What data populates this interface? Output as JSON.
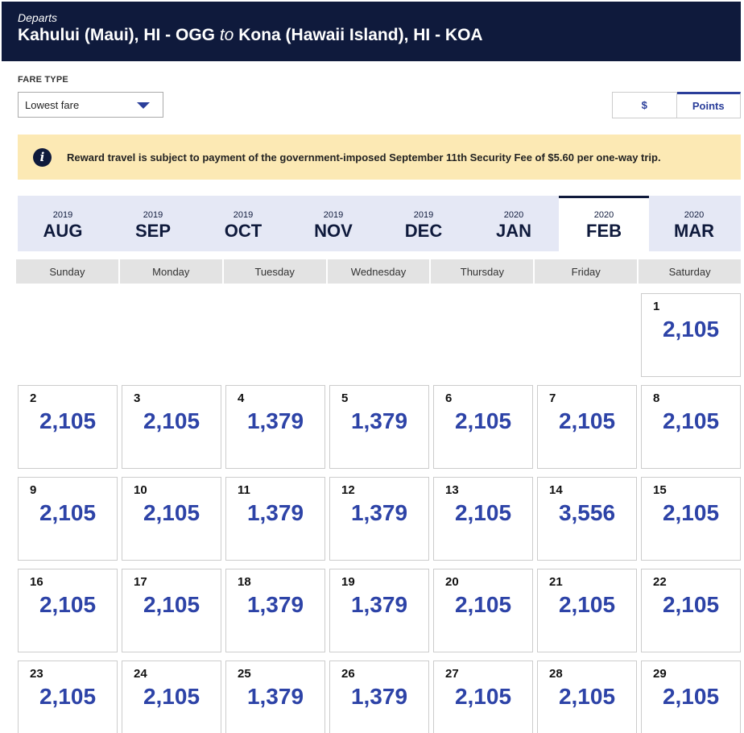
{
  "header": {
    "departs_label": "Departs",
    "origin": "Kahului (Maui), HI - OGG",
    "to_word": "to",
    "destination": "Kona (Hawaii Island), HI - KOA"
  },
  "fare_type": {
    "label": "FARE TYPE",
    "selected": "Lowest fare"
  },
  "currency_toggle": {
    "dollars": "$",
    "points": "Points",
    "active": "points"
  },
  "notice": {
    "icon": "info-icon",
    "message": "Reward travel is subject to payment of the government-imposed September 11th Security Fee of $5.60 per one-way trip."
  },
  "months": [
    {
      "year": "2019",
      "month": "AUG"
    },
    {
      "year": "2019",
      "month": "SEP"
    },
    {
      "year": "2019",
      "month": "OCT"
    },
    {
      "year": "2019",
      "month": "NOV"
    },
    {
      "year": "2019",
      "month": "DEC"
    },
    {
      "year": "2020",
      "month": "JAN"
    },
    {
      "year": "2020",
      "month": "FEB"
    },
    {
      "year": "2020",
      "month": "MAR"
    }
  ],
  "active_month": "FEB",
  "weekdays": [
    "Sunday",
    "Monday",
    "Tuesday",
    "Wednesday",
    "Thursday",
    "Friday",
    "Saturday"
  ],
  "calendar": [
    {
      "day": "1",
      "price": "2,105"
    },
    {
      "day": "2",
      "price": "2,105"
    },
    {
      "day": "3",
      "price": "2,105"
    },
    {
      "day": "4",
      "price": "1,379"
    },
    {
      "day": "5",
      "price": "1,379"
    },
    {
      "day": "6",
      "price": "2,105"
    },
    {
      "day": "7",
      "price": "2,105"
    },
    {
      "day": "8",
      "price": "2,105"
    },
    {
      "day": "9",
      "price": "2,105"
    },
    {
      "day": "10",
      "price": "2,105"
    },
    {
      "day": "11",
      "price": "1,379"
    },
    {
      "day": "12",
      "price": "1,379"
    },
    {
      "day": "13",
      "price": "2,105"
    },
    {
      "day": "14",
      "price": "3,556"
    },
    {
      "day": "15",
      "price": "2,105"
    },
    {
      "day": "16",
      "price": "2,105"
    },
    {
      "day": "17",
      "price": "2,105"
    },
    {
      "day": "18",
      "price": "1,379"
    },
    {
      "day": "19",
      "price": "1,379"
    },
    {
      "day": "20",
      "price": "2,105"
    },
    {
      "day": "21",
      "price": "2,105"
    },
    {
      "day": "22",
      "price": "2,105"
    },
    {
      "day": "23",
      "price": "2,105"
    },
    {
      "day": "24",
      "price": "2,105"
    },
    {
      "day": "25",
      "price": "1,379"
    },
    {
      "day": "26",
      "price": "1,379"
    },
    {
      "day": "27",
      "price": "2,105"
    },
    {
      "day": "28",
      "price": "2,105"
    },
    {
      "day": "29",
      "price": "2,105"
    }
  ],
  "colors": {
    "header_bg": "#0f1a3c",
    "accent": "#2d43a7",
    "notice_bg": "#fce9b4",
    "month_bar_bg": "#e5e8f5"
  }
}
